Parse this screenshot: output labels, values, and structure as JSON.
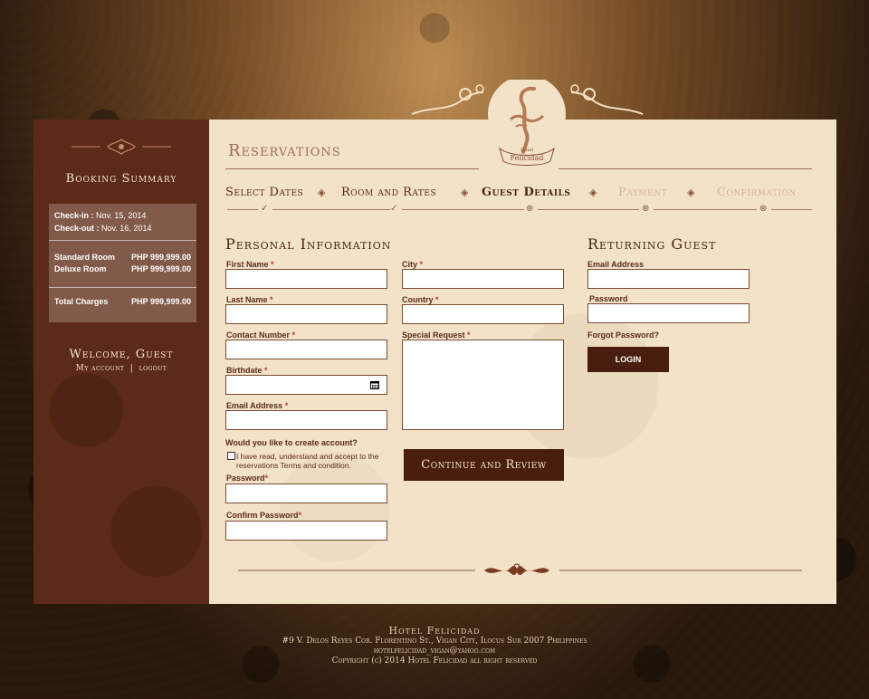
{
  "sidebar": {
    "title": "Booking Summary",
    "checkin_label": "Check-in :",
    "checkin_value": "Nov. 15, 2014",
    "checkout_label": "Check-out :",
    "checkout_value": "Nov. 16, 2014",
    "rooms": [
      {
        "name": "Standard Room",
        "price": "PHP 999,999.00"
      },
      {
        "name": "Deluxe Room",
        "price": "PHP 999,999.00"
      }
    ],
    "total_label": "Total Charges",
    "total_value": "PHP 999,999.00",
    "welcome": "Welcome, Guest",
    "my_account": "My account",
    "divider": "|",
    "logout": "logout"
  },
  "main": {
    "title": "Reservations",
    "logo_line1": "Hotel",
    "logo_line2": "Felicidad",
    "steps": [
      {
        "label": "Select Dates",
        "state": "done"
      },
      {
        "label": "Room and Rates",
        "state": "done"
      },
      {
        "label": "Guest Details",
        "state": "active"
      },
      {
        "label": "Payment",
        "state": "future"
      },
      {
        "label": "Confirmation",
        "state": "future"
      }
    ]
  },
  "personal": {
    "heading": "Personal Information",
    "first_name": "First Name",
    "last_name": "Last Name",
    "contact": "Contact Number",
    "birthdate": "Birthdate",
    "email": "Email Address",
    "city": "City",
    "country": "Country",
    "special": "Special Request",
    "create_q": "Would you like to create account?",
    "agree_line1": "I have read, understand and accept to the",
    "agree_line2": "reservations Terms and condition.",
    "password": "Password",
    "confirm_password": "Confirm Password",
    "continue": "Continue and Review"
  },
  "returning": {
    "heading": "Returning Guest",
    "email": "Email Address",
    "password": "Password",
    "forgot": "Forgot Password?",
    "login": "LOGIN"
  },
  "footer": {
    "name": "Hotel Felicidad",
    "address": "#9 V. Delos Reyes Cor. Florentino St., Vigan City, Ilocus Sur 2007 Philippines",
    "email": "hotelfelicidad_vigan@yahoo.com",
    "copyright": "Copyright (c) 2014 Hotel Felicidad all right reserved"
  },
  "colors": {
    "sidebar": "#5c2a18",
    "panel": "#f2e2c8",
    "button": "#4a1e0e",
    "accent": "#a06a55"
  }
}
